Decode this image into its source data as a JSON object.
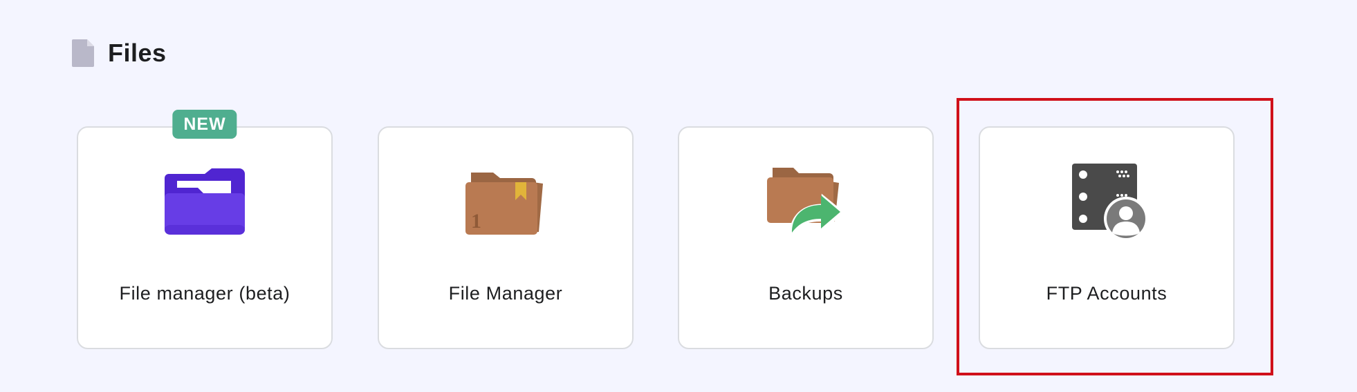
{
  "section": {
    "title": "Files",
    "icon": "document-icon"
  },
  "cards": [
    {
      "label": "File manager (beta)",
      "icon": "purple-folder-icon",
      "badge": "NEW"
    },
    {
      "label": "File Manager",
      "icon": "bookmark-folder-icon",
      "icon_text": "1"
    },
    {
      "label": "Backups",
      "icon": "folder-share-arrow-icon"
    },
    {
      "label": "FTP Accounts",
      "icon": "ftp-server-user-icon"
    }
  ],
  "colors": {
    "background": "#f4f5ff",
    "badge": "#4fae8f",
    "highlight": "#d0101a",
    "purple_folder": "#673de6",
    "brown_folder": "#b97a52",
    "green_arrow": "#4cb56f",
    "server_dark": "#4a4a4a"
  }
}
